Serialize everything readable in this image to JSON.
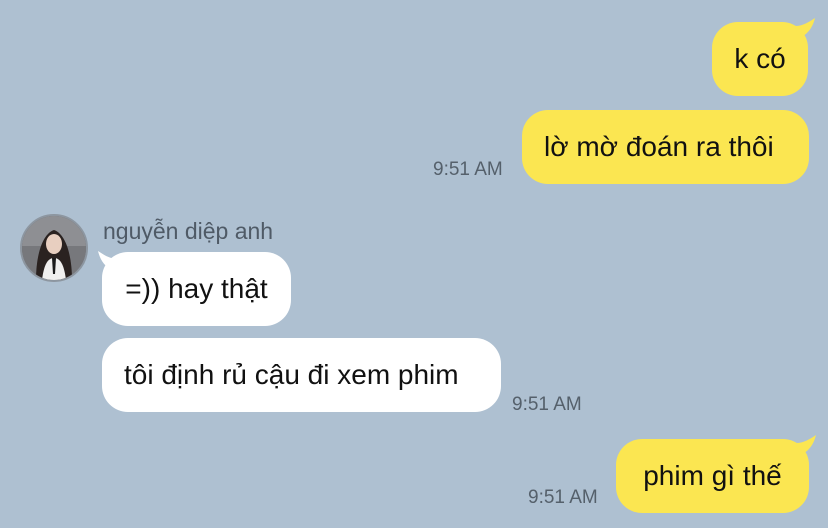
{
  "messages": [
    {
      "side": "me",
      "text": "k có"
    },
    {
      "side": "me",
      "text": "lờ mờ đoán ra thôi",
      "time": "9:51 AM"
    },
    {
      "side": "them",
      "sender": "nguyễn diệp anh",
      "text": "=)) hay thật"
    },
    {
      "side": "them",
      "text": "tôi định rủ cậu đi xem phim",
      "time": "9:51 AM"
    },
    {
      "side": "me",
      "text": "phim gì thế",
      "time": "9:51 AM"
    }
  ],
  "colors": {
    "background": "#aec0d1",
    "my_bubble": "#fbe651",
    "their_bubble": "#ffffff",
    "timestamp": "#55606b"
  },
  "icons": {
    "avatar": "profile-photo-avatar"
  }
}
